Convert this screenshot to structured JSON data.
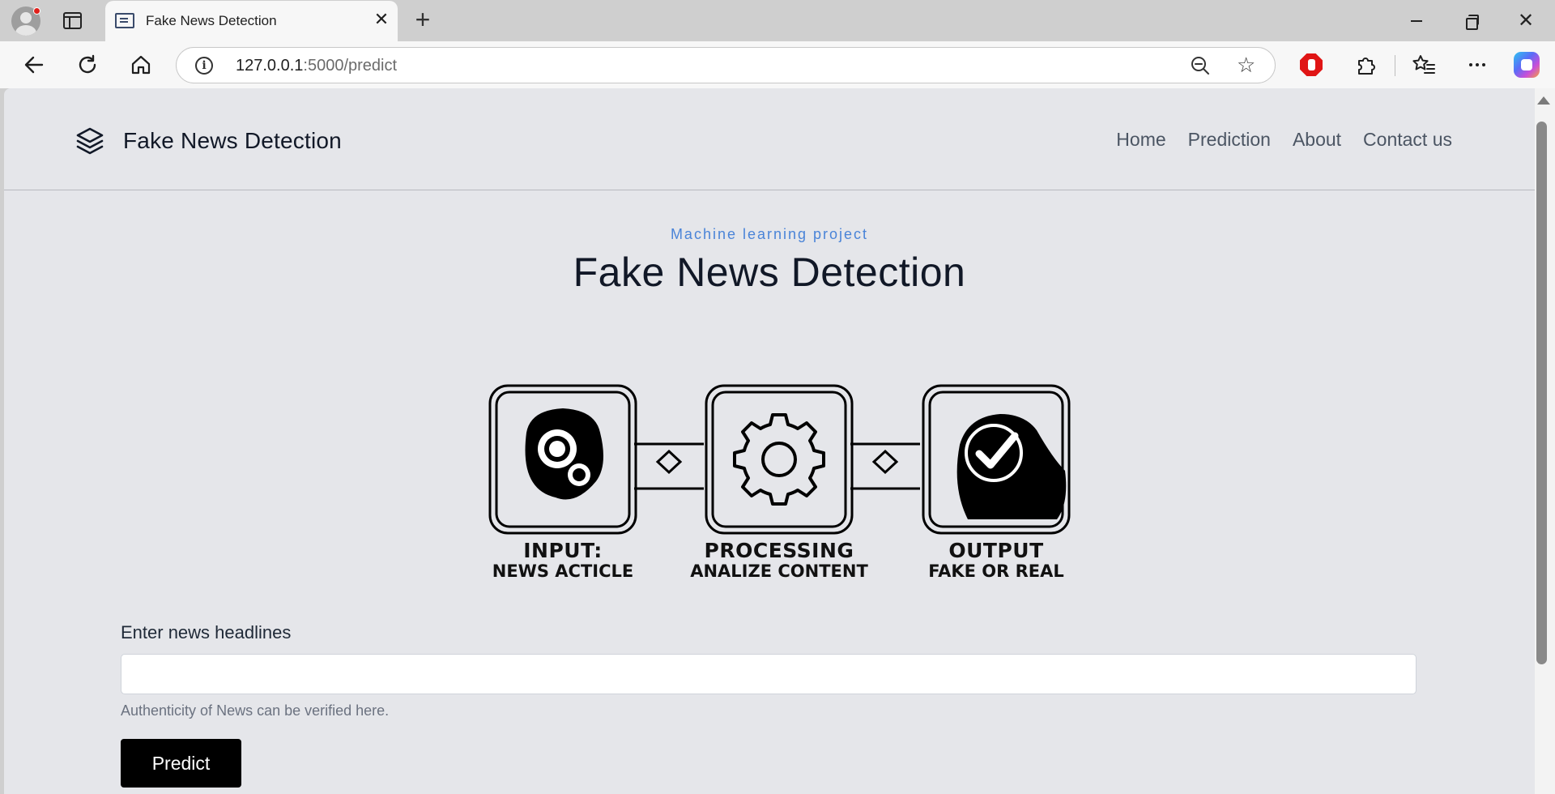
{
  "browser": {
    "tab_title": "Fake News Detection",
    "url_host": "127.0.0.1",
    "url_path": ":5000/predict"
  },
  "navbar": {
    "brand": "Fake News Detection",
    "links": [
      "Home",
      "Prediction",
      "About",
      "Contact us"
    ]
  },
  "hero": {
    "eyebrow": "Machine learning project",
    "title": "Fake News Detection"
  },
  "diagram": {
    "steps": [
      {
        "line1": "INPUT:",
        "line2": "NEWS ACTICLE",
        "icon": "search-icon"
      },
      {
        "line1": "PROCESSING",
        "line2": "ANALIZE CONTENT",
        "icon": "gear-icon"
      },
      {
        "line1": "OUTPUT",
        "line2": "FAKE OR REAL",
        "icon": "checkmark-icon"
      }
    ]
  },
  "form": {
    "label": "Enter news headlines",
    "input_value": "",
    "help_text": "Authenticity of News can be verified here.",
    "button_label": "Predict"
  },
  "colors": {
    "page_bg": "#e5e6ea",
    "accent": "#4a84d8",
    "button_bg": "#000000",
    "title_text": "#111827"
  }
}
